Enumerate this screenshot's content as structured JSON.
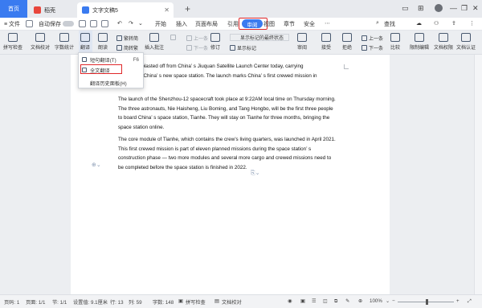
{
  "tabs": {
    "home": "首页",
    "docer": "稻壳",
    "document": "文字文稿5"
  },
  "menu": {
    "file": "≡ 文件",
    "start": "开始",
    "insert": "插入",
    "layout": "页面布局",
    "references": "引用",
    "review": "审阅",
    "view": "视图",
    "section": "章节",
    "security": "安全",
    "search": "查找",
    "auto_save": "自动保存"
  },
  "ribbon": {
    "spell_check": "拼写检查",
    "doc_proof": "文档校对",
    "word_count": "字数统计",
    "translate": "翻译",
    "read_aloud": "朗读",
    "trad_to_simp": "繁转简",
    "simp_to_trad": "简转繁",
    "insert_comment": "插入批注",
    "prev_comment": "上一条",
    "next_comment": "下一条",
    "revise": "修订",
    "show_markup_state": "显示标记的最终状态",
    "show_markup": "显示标记",
    "review": "审阅",
    "accept": "接受",
    "reject": "拒绝",
    "prev": "上一条",
    "next": "下一条",
    "compare": "比较",
    "restrict_edit": "限制编辑",
    "doc_perm": "文档权限",
    "doc_certify": "文档认证"
  },
  "dropdown": {
    "short_translate": "短句翻译(T)",
    "short_translate_key": "F6",
    "full_translate": "全文翻译",
    "translate_history": "翻译历史面板(H)"
  },
  "doc": {
    "p1": [
      "rch rocket blasted off from China’ s Jiuquan Satellite Launch Center today, carrying",
      "tronauts to China’ s new space station. The launch marks China’ s first crewed mission in"
    ],
    "p2": [
      "The launch of the Shenzhou-12 spacecraft took place at 9:22AM local time on Thursday morning.",
      "The three astronauts, Nie Haisheng, Liu Boming, and Tang Hongbo, will be the first three people",
      "to board China’ s space station, Tianhe. They will stay on Tianhe for three months, bringing the",
      "space station online."
    ],
    "p3": [
      "The core module of Tianhe, which contains the crew’s living quarters, was launched in April 2021.",
      "This first crewed mission is part of eleven planned missions during the space station’ s",
      "construction phase — two more modules and several more cargo and crewed missions need to",
      "be completed before the space station is finished in 2022."
    ]
  },
  "status": {
    "page_num": "页码: 1",
    "page": "页面: 1/1",
    "section": "节: 1/1",
    "setting": "设置值: 9.1厘米",
    "row": "行: 13",
    "col": "列: 59",
    "words": "字数: 148",
    "spell": "拼写检查",
    "proof": "文档校对",
    "zoom": "100%"
  },
  "colors": {
    "accent": "#3a7bf0",
    "highlight": "#e0282a"
  }
}
